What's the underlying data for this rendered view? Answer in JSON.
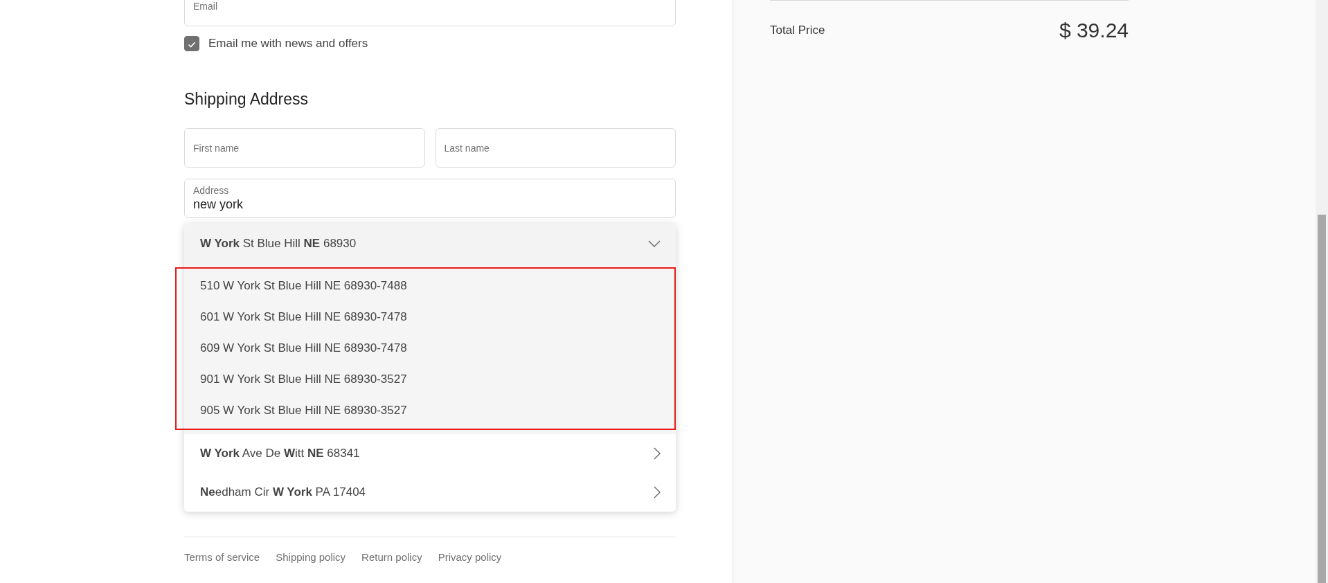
{
  "contact": {
    "email": {
      "placeholder": "Email"
    },
    "newsletter": {
      "label": "Email me with news and offers",
      "checked": true
    }
  },
  "shipping": {
    "title": "Shipping Address",
    "first_name": {
      "placeholder": "First name"
    },
    "last_name": {
      "placeholder": "Last name"
    },
    "address": {
      "label": "Address",
      "value": "new york"
    },
    "suggestions": [
      {
        "text": "**W York** St Blue Hill **NE** 68930",
        "expanded": true,
        "highlighted": true,
        "children": [
          {
            "text": "510 W York St Blue Hill NE 68930-7488"
          },
          {
            "text": "601 W York St Blue Hill NE 68930-7478"
          },
          {
            "text": "609 W York St Blue Hill NE 68930-7478"
          },
          {
            "text": "901 W York St Blue Hill NE 68930-3527"
          },
          {
            "text": "905 W York St Blue Hill NE 68930-3527"
          }
        ]
      },
      {
        "text": "**W York** Ave De **W**itt **NE** 68341",
        "expanded": false
      },
      {
        "text": "**Ne**edham Cir **W York** PA 17404",
        "expanded": false
      }
    ]
  },
  "footer_links": [
    "Terms of service",
    "Shipping policy",
    "Return policy",
    "Privacy policy"
  ],
  "summary": {
    "total_label": "Total Price",
    "total_value": "$ 39.24"
  }
}
